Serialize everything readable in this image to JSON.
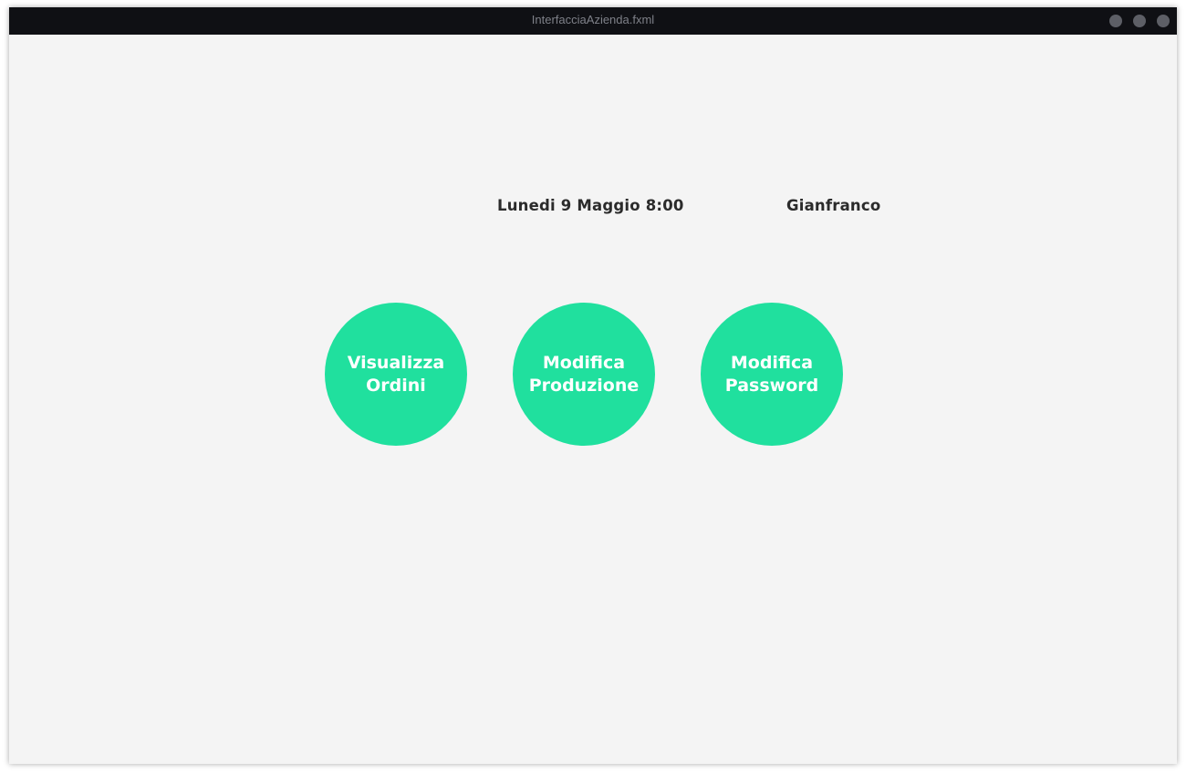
{
  "window": {
    "title": "InterfacciaAzienda.fxml",
    "controls": [
      "minimize-icon",
      "maximize-icon",
      "close-icon"
    ]
  },
  "header": {
    "date_time": "Lunedi 9 Maggio 8:00",
    "user_name": "Gianfranco"
  },
  "actions": {
    "view_orders": "Visualizza\nOrdini",
    "edit_production": "Modifica\nProduzione",
    "edit_password": "Modifica\nPassword"
  },
  "colors": {
    "accent": "#20e09e",
    "titlebar": "#0f1014",
    "background": "#f4f4f4",
    "text": "#2b2b2b"
  }
}
